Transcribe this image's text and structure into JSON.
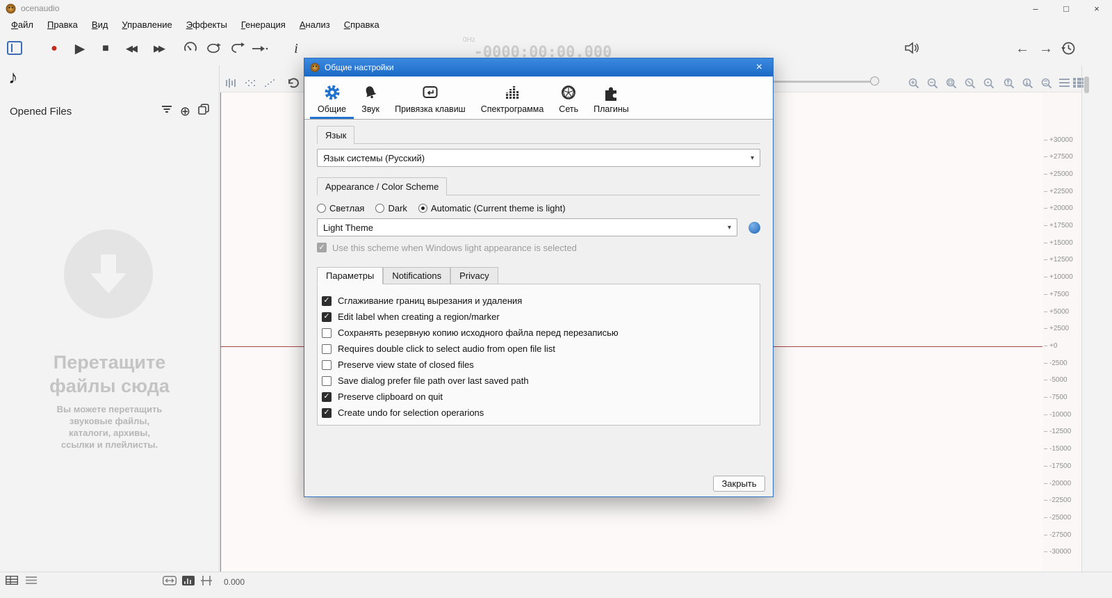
{
  "colors": {
    "accent": "#2273cf",
    "record_red": "#c62c1d",
    "wave_red": "#a84545"
  },
  "window": {
    "title": "ocenaudio",
    "menu": [
      "Файл",
      "Правка",
      "Вид",
      "Управление",
      "Эффекты",
      "Генерация",
      "Анализ",
      "Справка"
    ]
  },
  "toolbar": {
    "freq": "0Hz",
    "time": "-0000:00:00.000"
  },
  "sidebar": {
    "header": "Opened Files",
    "drop_title": "Перетащите\nфайлы сюда",
    "drop_hint": "Вы можете перетащить\nзвуковые файлы,\nкаталоги, архивы,\nссылки и плейлисты."
  },
  "editor": {
    "scale_labels": [
      "+30000",
      "+27500",
      "+25000",
      "+22500",
      "+20000",
      "+17500",
      "+15000",
      "+12500",
      "+10000",
      "+7500",
      "+5000",
      "+2500",
      "+0",
      "-2500",
      "-5000",
      "-7500",
      "-10000",
      "-12500",
      "-15000",
      "-17500",
      "-20000",
      "-22500",
      "-25000",
      "-27500",
      "-30000"
    ]
  },
  "statusbar": {
    "position": "0.000"
  },
  "dialog": {
    "title": "Общие настройки",
    "tabs": [
      {
        "label": "Общие",
        "selected": true
      },
      {
        "label": "Звук",
        "selected": false
      },
      {
        "label": "Привязка клавиш",
        "selected": false
      },
      {
        "label": "Спектрограмма",
        "selected": false
      },
      {
        "label": "Сеть",
        "selected": false
      },
      {
        "label": "Плагины",
        "selected": false
      }
    ],
    "language_group": "Язык",
    "language_value": "Язык системы (Русский)",
    "appearance_group": "Appearance / Color Scheme",
    "radios": [
      {
        "label": "Светлая",
        "checked": false
      },
      {
        "label": "Dark",
        "checked": false
      },
      {
        "label": "Automatic (Current theme is light)",
        "checked": true
      }
    ],
    "theme_value": "Light Theme",
    "scheme_note": {
      "label": "Use this scheme when Windows light appearance is selected",
      "checked": true
    },
    "subtabs": [
      {
        "label": "Параметры",
        "selected": true
      },
      {
        "label": "Notifications",
        "selected": false
      },
      {
        "label": "Privacy",
        "selected": false
      }
    ],
    "options": [
      {
        "label": "Сглаживание границ вырезания и удаления",
        "checked": true
      },
      {
        "label": "Edit label when creating a region/marker",
        "checked": true
      },
      {
        "label": "Сохранять резервную копию исходного файла перед перезаписью",
        "checked": false
      },
      {
        "label": "Requires double click to select audio from open file list",
        "checked": false
      },
      {
        "label": "Preserve view state of closed files",
        "checked": false
      },
      {
        "label": "Save dialog prefer file path over last saved path",
        "checked": false
      },
      {
        "label": "Preserve clipboard on quit",
        "checked": true
      },
      {
        "label": "Create undo for selection operarions",
        "checked": true
      }
    ],
    "close_button": "Закрыть"
  },
  "icons": {
    "check": "✓",
    "dropdown": "▾",
    "close": "×",
    "minimize": "–",
    "maximize": "□",
    "record": "●",
    "play": "▶",
    "stop": "■",
    "rewind": "◀◀",
    "forward": "▶▶",
    "music_note": "♪",
    "info": "i",
    "back_arrow": "←",
    "fwd_arrow": "→",
    "plus": "⊕"
  }
}
